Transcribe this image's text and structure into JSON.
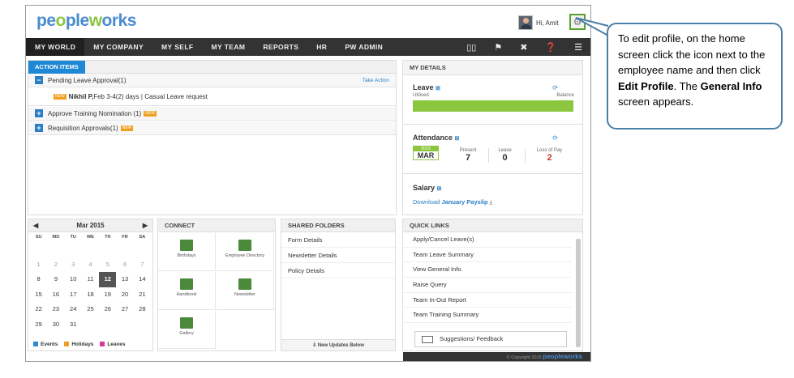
{
  "logo": {
    "pe": "pe",
    "o": "o",
    "ple": "ple",
    "w": "w",
    "o2": "o",
    "rks": "rks"
  },
  "greeting": "Hi, Amit",
  "nav": {
    "items": [
      "MY WORLD",
      "MY COMPANY",
      "MY SELF",
      "MY TEAM",
      "REPORTS",
      "HR",
      "PW ADMIN"
    ]
  },
  "actions": {
    "tab": "ACTION ITEMS",
    "pending": "Pending Leave Approval(1)",
    "take_action": "Take Action",
    "new": "NEW",
    "leave_entry_name": "Nikhil P,",
    "leave_entry_rest": " Feb 3-4(2) days | Casual Leave request",
    "training": "Approve Training Nomination (1)",
    "requisition": "Requisition Approvals(1)"
  },
  "details": {
    "title": "MY DETAILS",
    "leave": "Leave",
    "utilised": "Utilised",
    "balance": "Balance",
    "attendance": "Attendance",
    "year": "2015",
    "month": "MAR",
    "present_label": "Present",
    "present": "7",
    "leave_label": "Leave",
    "leave_count": "0",
    "lop_label": "Loss of Pay",
    "lop": "2",
    "salary": "Salary",
    "download_prefix": "Download",
    "payslip": "January Payslip"
  },
  "calendar": {
    "month": "Mar 2015",
    "days": [
      "SU",
      "MO",
      "TU",
      "WE",
      "TH",
      "FR",
      "SA"
    ],
    "weeks": [
      [
        "",
        "",
        "",
        "",
        "",
        "",
        ""
      ],
      [
        "1",
        "2",
        "3",
        "4",
        "5",
        "6",
        "7"
      ],
      [
        "8",
        "9",
        "10",
        "11",
        "12",
        "13",
        "14"
      ],
      [
        "15",
        "16",
        "17",
        "18",
        "19",
        "20",
        "21"
      ],
      [
        "22",
        "23",
        "24",
        "25",
        "26",
        "27",
        "28"
      ],
      [
        "29",
        "30",
        "31",
        "",
        "",
        "",
        ""
      ]
    ],
    "legend": {
      "events": "Events",
      "holidays": "Holidays",
      "leaves": "Leaves"
    },
    "colors": {
      "events": "#2a8ad4",
      "holidays": "#f0a020",
      "leaves": "#d93b9c"
    }
  },
  "connect": {
    "title": "CONNECT",
    "items": [
      "Birthdays",
      "Employee Directory",
      "Handbook",
      "Newsletter",
      "Gallery"
    ]
  },
  "shared": {
    "title": "SHARED FOLDERS",
    "items": [
      "Form Details",
      "Newsletter Details",
      "Policy Details"
    ],
    "updates": "New Updates Below"
  },
  "quick": {
    "title": "QUICK LINKS",
    "items": [
      "Apply/Cancel Leave(s)",
      "Team Leave Summary",
      "View General Info.",
      "Raise Query",
      "Team In-Out Report",
      "Team Training Summary"
    ],
    "feedback": "Suggestions/ Feedback"
  },
  "footer": {
    "copyright": "© Copyright 2015",
    "brand": "peopleworks"
  },
  "callout": {
    "t1": "To edit profile, on the home screen click the icon next to the employee name and then click ",
    "b1": "Edit Profile",
    "t2": ". The ",
    "b2": "General Info",
    "t3": " screen appears."
  }
}
